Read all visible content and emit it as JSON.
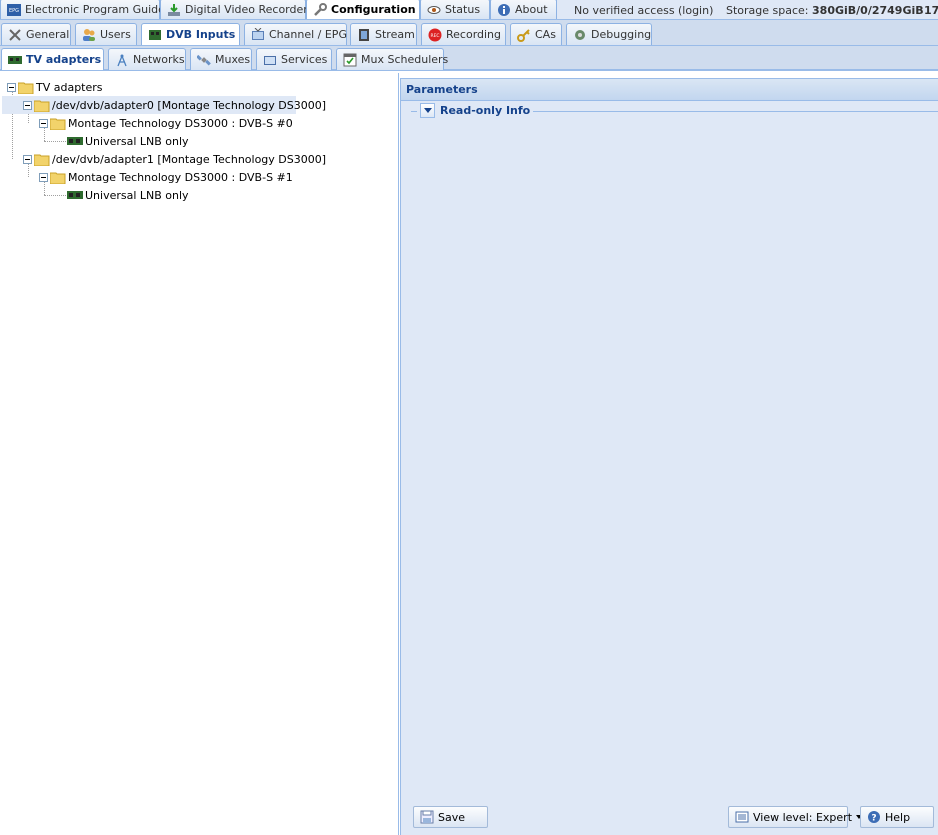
{
  "top_tabs": [
    {
      "label": "Electronic Program Guide",
      "icon": "epg-icon"
    },
    {
      "label": "Digital Video Recorder",
      "icon": "dvr-download-icon"
    },
    {
      "label": "Configuration",
      "icon": "wrench-icon"
    },
    {
      "label": "Status",
      "icon": "eye-icon"
    },
    {
      "label": "About",
      "icon": "info-icon"
    }
  ],
  "access": {
    "status": "No verified access",
    "login": "(login)"
  },
  "storage": {
    "label": "Storage space:",
    "value": "380GiB/0/2749GiB",
    "trailing": "17"
  },
  "config_tabs": [
    {
      "label": "General",
      "icon": "tools-icon"
    },
    {
      "label": "Users",
      "icon": "users-icon"
    },
    {
      "label": "DVB Inputs",
      "icon": "dvb-card-icon"
    },
    {
      "label": "Channel / EPG",
      "icon": "tv-icon"
    },
    {
      "label": "Stream",
      "icon": "film-icon"
    },
    {
      "label": "Recording",
      "icon": "rec-icon"
    },
    {
      "label": "CAs",
      "icon": "key-icon"
    },
    {
      "label": "Debugging",
      "icon": "bug-icon"
    }
  ],
  "dvb_tabs": [
    {
      "label": "TV adapters",
      "icon": "tv-adapter-icon"
    },
    {
      "label": "Networks",
      "icon": "antenna-icon"
    },
    {
      "label": "Muxes",
      "icon": "satellite-icon"
    },
    {
      "label": "Services",
      "icon": "tv-service-icon"
    },
    {
      "label": "Mux Schedulers",
      "icon": "calendar-check-icon"
    }
  ],
  "tree": {
    "root": "TV adapters",
    "adapters": [
      {
        "label": "/dev/dvb/adapter0 [Montage Technology DS3000]",
        "frontend": "Montage Technology DS3000 : DVB-S #0",
        "satconf": "Universal LNB only"
      },
      {
        "label": "/dev/dvb/adapter1 [Montage Technology DS3000]",
        "frontend": "Montage Technology DS3000 : DVB-S #1",
        "satconf": "Universal LNB only"
      }
    ]
  },
  "params": {
    "title": "Parameters",
    "section": "Read-only Info",
    "save_label": "Save",
    "view_level_label": "View level: Expert",
    "help_label": "Help"
  },
  "colors": {
    "accent": "#15428b",
    "panel_bg": "#dfe8f6",
    "border": "#99bbe8"
  }
}
